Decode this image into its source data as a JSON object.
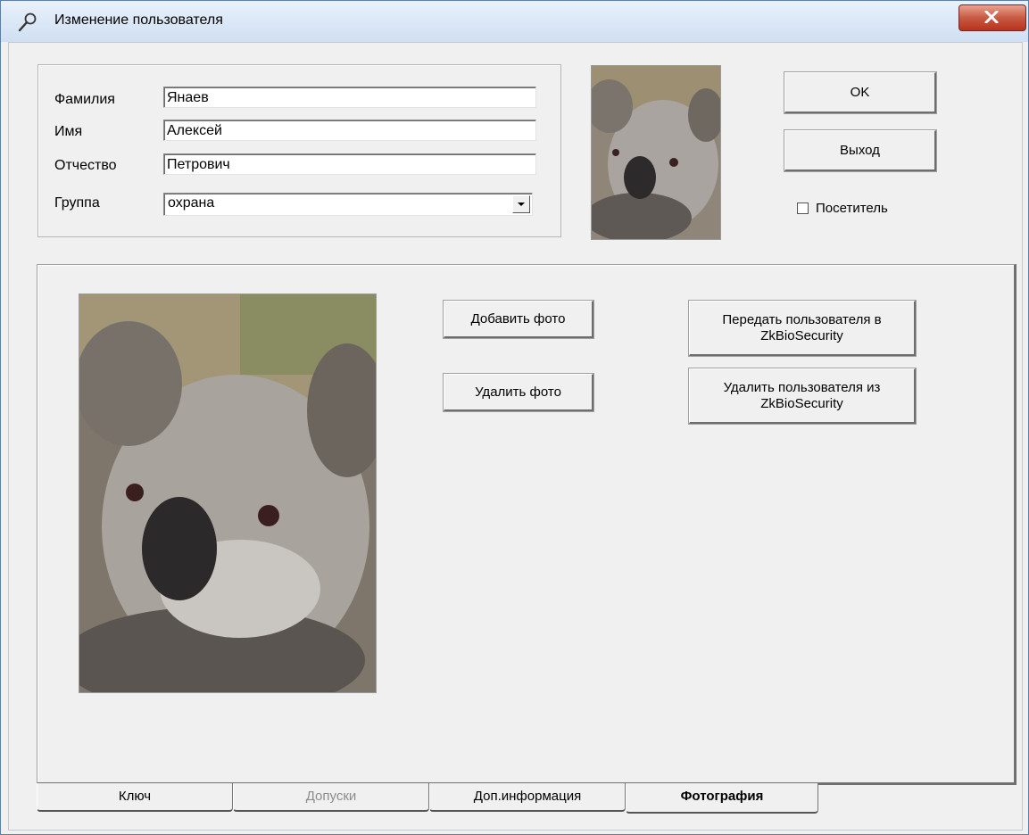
{
  "window": {
    "title": "Изменение пользователя"
  },
  "form": {
    "surname_label": "Фамилия",
    "surname_value": "Янаев",
    "name_label": "Имя",
    "name_value": "Алексей",
    "patronymic_label": "Отчество",
    "patronymic_value": "Петрович",
    "group_label": "Группа",
    "group_value": "охрана"
  },
  "actions": {
    "ok": "OK",
    "exit": "Выход",
    "visitor_label": "Посетитель",
    "visitor_checked": false
  },
  "photo_tab": {
    "add_photo": "Добавить фото",
    "delete_photo": "Удалить фото",
    "send_user": "Передать пользователя в ZkBioSecurity",
    "delete_user": "Удалить пользователя из ZkBioSecurity"
  },
  "tabs": [
    {
      "label": "Ключ",
      "state": "normal"
    },
    {
      "label": "Допуски",
      "state": "disabled"
    },
    {
      "label": "Доп.информация",
      "state": "normal"
    },
    {
      "label": "Фотография",
      "state": "active"
    }
  ],
  "icons": {
    "title_icon": "wrench-icon",
    "close_icon": "close-icon",
    "dropdown_icon": "chevron-down-icon"
  },
  "colors": {
    "close_button": "#c75a43",
    "titlebar": "#dbe7f5"
  }
}
